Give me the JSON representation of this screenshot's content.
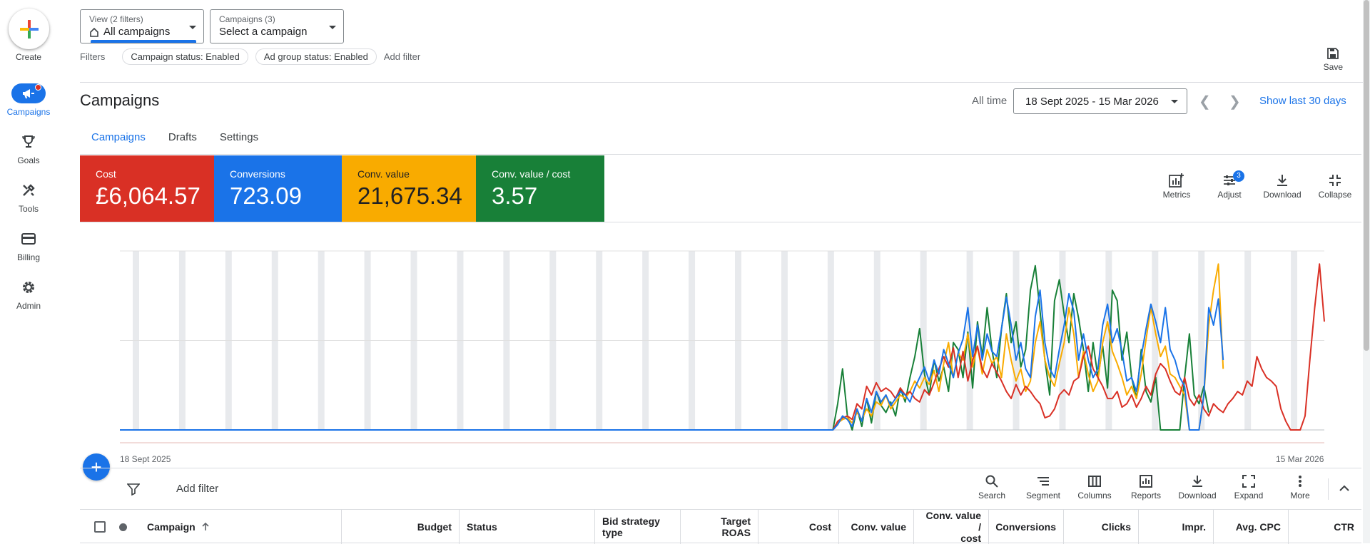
{
  "rail": {
    "create": "Create",
    "items": [
      {
        "label": "Campaigns",
        "icon": "megaphone-icon",
        "active": true
      },
      {
        "label": "Goals",
        "icon": "trophy-icon"
      },
      {
        "label": "Tools",
        "icon": "tools-icon"
      },
      {
        "label": "Billing",
        "icon": "card-icon"
      },
      {
        "label": "Admin",
        "icon": "gear-icon"
      }
    ]
  },
  "view_dd": {
    "small": "View (2 filters)",
    "value": "All campaigns"
  },
  "campaign_dd": {
    "small": "Campaigns (3)",
    "value": "Select a campaign"
  },
  "filters": {
    "label": "Filters",
    "chips": [
      "Campaign status: Enabled",
      "Ad group status: Enabled"
    ],
    "add": "Add filter"
  },
  "save": "Save",
  "page_title": "Campaigns",
  "date": {
    "all_time": "All time",
    "range": "18 Sept 2025 - 15 Mar 2026",
    "show_last": "Show last 30 days"
  },
  "tabs": [
    "Campaigns",
    "Drafts",
    "Settings"
  ],
  "tiles": [
    {
      "label": "Cost",
      "value": "£6,064.57",
      "color": "#d93025"
    },
    {
      "label": "Conversions",
      "value": "723.09",
      "color": "#1a73e8"
    },
    {
      "label": "Conv. value",
      "value": "21,675.34",
      "color": "#f9ab00"
    },
    {
      "label": "Conv. value / cost",
      "value": "3.57",
      "color": "#188038"
    }
  ],
  "chart_tools": {
    "metrics": "Metrics",
    "adjust": "Adjust",
    "adjust_count": "3",
    "download": "Download",
    "collapse": "Collapse"
  },
  "chart_data": {
    "type": "line",
    "x_start": "18 Sept 2025",
    "x_end": "15 Mar 2026",
    "series": [
      {
        "name": "Cost",
        "color": "#d93025",
        "values": [
          0,
          0,
          0,
          0,
          0,
          0,
          0,
          0,
          0,
          0,
          0,
          0,
          0,
          0,
          0,
          0,
          0,
          0,
          0,
          0,
          0,
          0,
          0,
          0,
          0,
          0,
          0,
          0,
          0,
          0,
          0,
          0,
          0,
          0,
          0,
          0,
          0,
          0,
          0,
          0,
          0,
          0,
          0,
          0,
          0,
          0,
          0,
          0,
          0,
          0,
          0,
          0,
          0,
          0,
          0,
          0,
          0,
          0,
          0,
          0,
          0,
          0,
          0,
          0,
          0,
          0,
          0,
          0,
          0,
          0,
          0,
          0,
          0,
          0,
          0,
          0,
          0,
          0,
          0,
          0,
          0,
          0,
          0,
          0,
          0,
          0,
          0,
          0,
          0,
          0,
          0,
          0,
          0,
          0,
          0,
          0,
          0,
          0,
          0,
          0,
          0,
          0,
          0,
          0,
          0,
          0,
          0,
          0,
          0,
          0,
          0,
          0,
          0,
          0,
          0,
          0,
          0,
          0,
          0,
          0,
          0,
          0,
          0,
          0,
          0,
          0,
          0,
          0,
          0,
          0,
          0,
          0,
          0,
          0,
          0,
          0,
          0,
          0,
          0,
          0,
          0,
          0,
          0,
          0,
          0,
          0,
          0,
          0,
          0,
          5,
          7,
          8,
          6,
          15,
          12,
          25,
          20,
          27,
          22,
          24,
          22,
          18,
          24,
          20,
          22,
          18,
          16,
          23,
          20,
          27,
          35,
          42,
          36,
          47,
          30,
          45,
          28,
          40,
          48,
          35,
          30,
          38,
          33,
          28,
          22,
          18,
          26,
          20,
          25,
          22,
          18,
          15,
          7,
          8,
          12,
          20,
          23,
          20,
          28,
          30,
          42,
          48,
          35,
          30,
          25,
          18,
          18,
          22,
          13,
          15,
          20,
          13,
          18,
          25,
          20,
          32,
          38,
          35,
          28,
          22,
          20,
          30,
          18,
          14,
          20,
          12,
          8,
          15,
          12,
          10,
          15,
          18,
          22,
          20,
          28,
          25,
          42,
          35,
          30,
          28,
          25,
          12,
          5,
          0,
          0,
          0,
          8,
          40,
          70,
          95,
          62
        ]
      },
      {
        "name": "Conversions",
        "color": "#1a73e8",
        "values": [
          0,
          0,
          0,
          0,
          0,
          0,
          0,
          0,
          0,
          0,
          0,
          0,
          0,
          0,
          0,
          0,
          0,
          0,
          0,
          0,
          0,
          0,
          0,
          0,
          0,
          0,
          0,
          0,
          0,
          0,
          0,
          0,
          0,
          0,
          0,
          0,
          0,
          0,
          0,
          0,
          0,
          0,
          0,
          0,
          0,
          0,
          0,
          0,
          0,
          0,
          0,
          0,
          0,
          0,
          0,
          0,
          0,
          0,
          0,
          0,
          0,
          0,
          0,
          0,
          0,
          0,
          0,
          0,
          0,
          0,
          0,
          0,
          0,
          0,
          0,
          0,
          0,
          0,
          0,
          0,
          0,
          0,
          0,
          0,
          0,
          0,
          0,
          0,
          0,
          0,
          0,
          0,
          0,
          0,
          0,
          0,
          0,
          0,
          0,
          0,
          0,
          0,
          0,
          0,
          0,
          0,
          0,
          0,
          0,
          0,
          0,
          0,
          0,
          0,
          0,
          0,
          0,
          0,
          0,
          0,
          0,
          0,
          0,
          0,
          0,
          0,
          0,
          0,
          0,
          0,
          0,
          0,
          0,
          0,
          0,
          0,
          0,
          0,
          0,
          0,
          0,
          0,
          0,
          0,
          0,
          0,
          0,
          0,
          0,
          3,
          8,
          6,
          2,
          12,
          5,
          18,
          10,
          22,
          16,
          20,
          14,
          18,
          22,
          20,
          16,
          24,
          30,
          36,
          28,
          40,
          32,
          46,
          38,
          30,
          44,
          52,
          70,
          42,
          60,
          40,
          55,
          45,
          42,
          58,
          76,
          60,
          40,
          50,
          35,
          30,
          65,
          80,
          50,
          35,
          30,
          46,
          60,
          78,
          68,
          40,
          55,
          40,
          30,
          35,
          60,
          72,
          50,
          58,
          45,
          28,
          30,
          22,
          42,
          58,
          72,
          62,
          50,
          70,
          46,
          40,
          30,
          25,
          0,
          0,
          0,
          20,
          70,
          60,
          75,
          40
        ]
      },
      {
        "name": "Conv. value",
        "color": "#f9ab00",
        "values": [
          0,
          0,
          0,
          0,
          0,
          0,
          0,
          0,
          0,
          0,
          0,
          0,
          0,
          0,
          0,
          0,
          0,
          0,
          0,
          0,
          0,
          0,
          0,
          0,
          0,
          0,
          0,
          0,
          0,
          0,
          0,
          0,
          0,
          0,
          0,
          0,
          0,
          0,
          0,
          0,
          0,
          0,
          0,
          0,
          0,
          0,
          0,
          0,
          0,
          0,
          0,
          0,
          0,
          0,
          0,
          0,
          0,
          0,
          0,
          0,
          0,
          0,
          0,
          0,
          0,
          0,
          0,
          0,
          0,
          0,
          0,
          0,
          0,
          0,
          0,
          0,
          0,
          0,
          0,
          0,
          0,
          0,
          0,
          0,
          0,
          0,
          0,
          0,
          0,
          0,
          0,
          0,
          0,
          0,
          0,
          0,
          0,
          0,
          0,
          0,
          0,
          0,
          0,
          0,
          0,
          0,
          0,
          0,
          0,
          0,
          0,
          0,
          0,
          0,
          0,
          0,
          0,
          0,
          0,
          0,
          0,
          0,
          0,
          0,
          0,
          0,
          0,
          0,
          0,
          0,
          0,
          0,
          0,
          0,
          0,
          0,
          0,
          0,
          0,
          0,
          0,
          0,
          0,
          0,
          0,
          0,
          0,
          0,
          0,
          4,
          6,
          7,
          4,
          10,
          6,
          12,
          8,
          16,
          14,
          20,
          12,
          16,
          20,
          18,
          22,
          28,
          24,
          30,
          26,
          34,
          22,
          38,
          50,
          30,
          44,
          40,
          55,
          36,
          48,
          32,
          46,
          38,
          42,
          30,
          55,
          40,
          28,
          35,
          22,
          28,
          50,
          62,
          40,
          30,
          25,
          38,
          50,
          70,
          55,
          30,
          45,
          32,
          22,
          28,
          50,
          62,
          45,
          38,
          30,
          20,
          25,
          18,
          32,
          52,
          70,
          55,
          42,
          48,
          32,
          30,
          25,
          20,
          0,
          0,
          0,
          20,
          60,
          80,
          95,
          35
        ]
      },
      {
        "name": "Conv. value / cost",
        "color": "#188038",
        "values": [
          0,
          0,
          0,
          0,
          0,
          0,
          0,
          0,
          0,
          0,
          0,
          0,
          0,
          0,
          0,
          0,
          0,
          0,
          0,
          0,
          0,
          0,
          0,
          0,
          0,
          0,
          0,
          0,
          0,
          0,
          0,
          0,
          0,
          0,
          0,
          0,
          0,
          0,
          0,
          0,
          0,
          0,
          0,
          0,
          0,
          0,
          0,
          0,
          0,
          0,
          0,
          0,
          0,
          0,
          0,
          0,
          0,
          0,
          0,
          0,
          0,
          0,
          0,
          0,
          0,
          0,
          0,
          0,
          0,
          0,
          0,
          0,
          0,
          0,
          0,
          0,
          0,
          0,
          0,
          0,
          0,
          0,
          0,
          0,
          0,
          0,
          0,
          0,
          0,
          0,
          0,
          0,
          0,
          0,
          0,
          0,
          0,
          0,
          0,
          0,
          0,
          0,
          0,
          0,
          0,
          0,
          0,
          0,
          0,
          0,
          0,
          0,
          0,
          0,
          0,
          0,
          0,
          0,
          0,
          0,
          0,
          0,
          0,
          0,
          0,
          0,
          0,
          0,
          0,
          0,
          0,
          0,
          0,
          0,
          0,
          0,
          0,
          0,
          0,
          0,
          0,
          0,
          0,
          0,
          0,
          0,
          0,
          0,
          0,
          15,
          35,
          8,
          0,
          12,
          2,
          18,
          4,
          22,
          14,
          10,
          16,
          8,
          24,
          16,
          30,
          42,
          58,
          32,
          20,
          40,
          28,
          36,
          22,
          50,
          46,
          30,
          56,
          24,
          62,
          42,
          70,
          46,
          30,
          58,
          78,
          50,
          62,
          36,
          46,
          80,
          94,
          68,
          40,
          20,
          74,
          86,
          66,
          50,
          78,
          64,
          46,
          22,
          50,
          30,
          48,
          24,
          80,
          74,
          40,
          56,
          30,
          18,
          46,
          22,
          16,
          30,
          0,
          0,
          0,
          0,
          0,
          30,
          55,
          20,
          15,
          25,
          10
        ]
      }
    ]
  },
  "table_bar": {
    "add_filter": "Add filter",
    "tools": [
      {
        "label": "Search",
        "icon": "search-icon"
      },
      {
        "label": "Segment",
        "icon": "segment-icon"
      },
      {
        "label": "Columns",
        "icon": "columns-icon"
      },
      {
        "label": "Reports",
        "icon": "reports-icon"
      },
      {
        "label": "Download",
        "icon": "download-icon"
      },
      {
        "label": "Expand",
        "icon": "expand-icon"
      },
      {
        "label": "More",
        "icon": "more-icon"
      }
    ]
  },
  "columns": {
    "campaign": "Campaign",
    "budget": "Budget",
    "status": "Status",
    "bid_strategy_1": "Bid strategy",
    "bid_strategy_2": "type",
    "target_roas_1": "Target",
    "target_roas_2": "ROAS",
    "cost": "Cost",
    "conv_value": "Conv. value",
    "conv_value_cost_1": "Conv. value /",
    "conv_value_cost_2": "cost",
    "conversions": "Conversions",
    "clicks": "Clicks",
    "impr": "Impr.",
    "avg_cpc": "Avg. CPC",
    "ctr": "CTR"
  }
}
